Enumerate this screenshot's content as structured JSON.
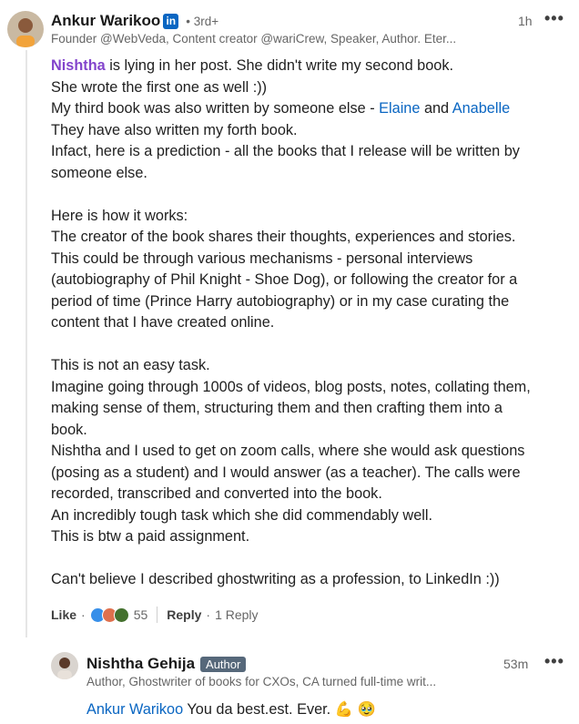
{
  "comment": {
    "author": "Ankur Warikoo",
    "linkedin_badge": "in",
    "degree": "• 3rd+",
    "time": "1h",
    "more_icon": "more-horizontal",
    "headline": "Founder @WebVeda, Content creator @wariCrew, Speaker, Author. Eter...",
    "body": {
      "l1_mention": "Nishtha",
      "l1_rest": " is lying in her post. She didn't write my second book.",
      "l2": "She wrote the first one as well :))",
      "l3_pre": "My third book was also written by someone else - ",
      "l3_m1": "Elaine",
      "l3_and": " and ",
      "l3_m2": "Anabelle",
      "l4": "They have also written my forth book.",
      "l5": "Infact, here is a prediction - all the books that I release will be written by",
      "l6": "someone else.",
      "l8": "Here is how it works:",
      "l9": "The creator of the book shares their thoughts, experiences and stories.",
      "l10": "This could be through various mechanisms - personal interviews",
      "l11": "(autobiography of Phil Knight - Shoe Dog), or following the creator for a",
      "l12": "period of time (Prince Harry autobiography) or in my case curating the",
      "l13": "content that I have created online.",
      "l15": "This is not an easy task.",
      "l16": "Imagine going through 1000s of videos, blog posts, notes, collating them,",
      "l17": "making sense of them, structuring them and then crafting them into a",
      "l18": "book.",
      "l19": "Nishtha and I used to get on zoom calls, where she would ask questions",
      "l20": "(posing as a student) and I would answer (as a teacher). The calls were",
      "l21": "recorded, transcribed and converted into the book.",
      "l22": "An incredibly tough task which she did commendably well.",
      "l23": "This is btw a paid assignment.",
      "l25": "Can't believe I described ghostwriting as a profession, to LinkedIn :))"
    },
    "actions": {
      "like": "Like",
      "sep1": "·",
      "reaction_count": "55",
      "reply": "Reply",
      "sep2": "·",
      "reply_count": "1 Reply"
    }
  },
  "reply": {
    "author": "Nishtha Gehija",
    "badge": "Author",
    "time": "53m",
    "more_icon": "more-horizontal",
    "headline": "Author, Ghostwriter of books for CXOs, CA turned full-time writ...",
    "mention": "Ankur Warikoo",
    "text": " You da best.est. Ever. 💪 🥹"
  },
  "colors": {
    "link_blue": "#0a66c2",
    "mention_purple": "#8344cc",
    "badge_gray": "#56687a",
    "muted_text": "#666666"
  }
}
